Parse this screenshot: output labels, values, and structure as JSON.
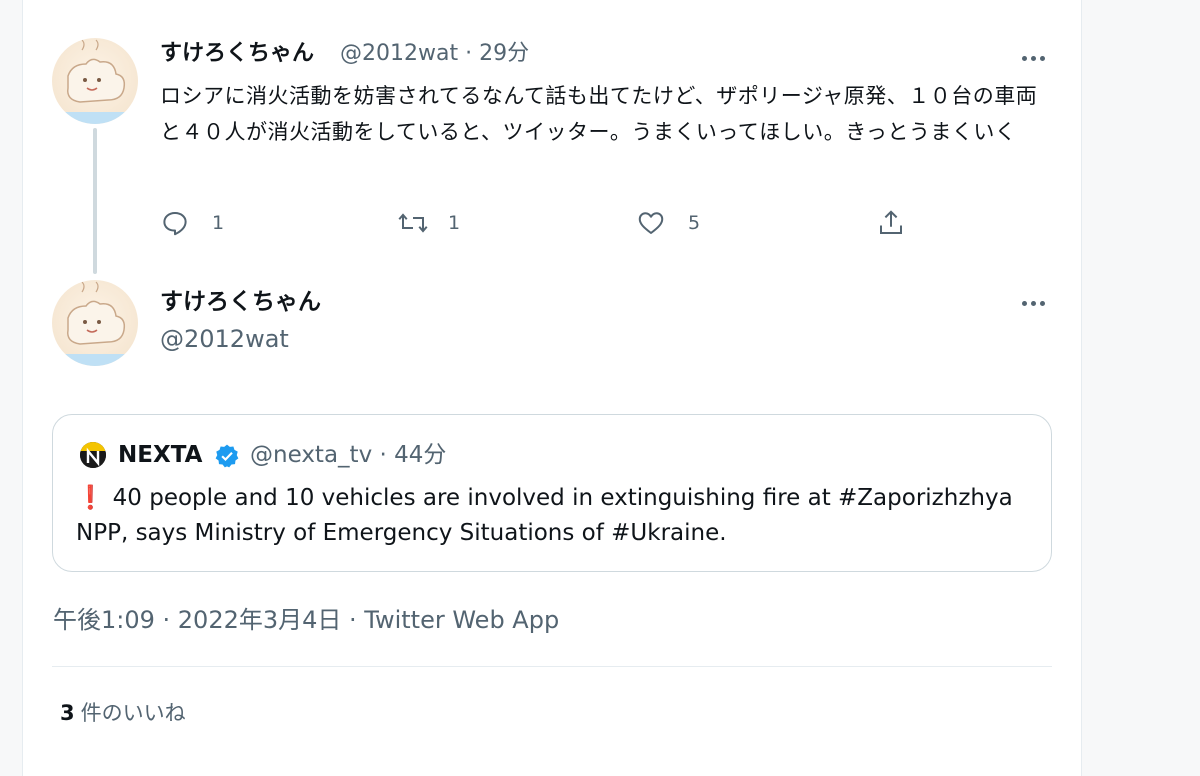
{
  "tweet1": {
    "display_name": "すけろくちゃん",
    "handle_time": "@2012wat · 29分",
    "text": "ロシアに消火活動を妨害されてるなんて話も出てたけど、ザポリージャ原発、１０台の車両と４０人が消火活動をしていると、ツイッター。うまくいってほしい。きっとうまくいく",
    "actions": {
      "replies": "1",
      "retweets": "1",
      "likes": "5"
    }
  },
  "tweet2": {
    "display_name": "すけろくちゃん",
    "handle": "@2012wat"
  },
  "quote": {
    "name": "NEXTA",
    "handle_time": "@nexta_tv · 44分",
    "exclamation": "❗",
    "text": "40 people and 10 vehicles are involved in extinguishing fire at #Zaporizhzhya NPP, says Ministry of Emergency Situations of #Ukraine."
  },
  "timestamp": "午後1:09 · 2022年3月4日 · Twitter Web App",
  "likes_summary": {
    "count": "3",
    "label": "件のいいね"
  },
  "icons": [
    "more-icon",
    "reply-icon",
    "retweet-icon",
    "like-icon",
    "share-icon",
    "verified-badge-icon",
    "nexta-logo-icon"
  ],
  "colors": {
    "text": "#0f1419",
    "secondary": "#536471",
    "verified": "#1d9bf0",
    "border": "#cfd9de"
  }
}
